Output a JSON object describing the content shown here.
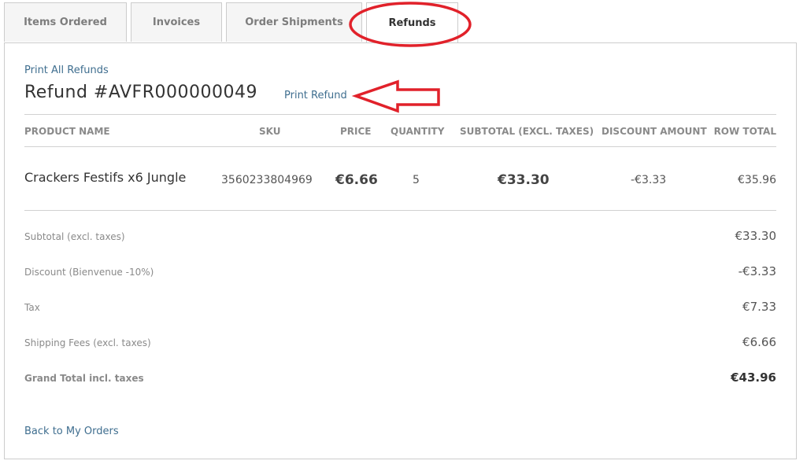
{
  "tabs": [
    {
      "label": "Items Ordered"
    },
    {
      "label": "Invoices"
    },
    {
      "label": "Order Shipments"
    },
    {
      "label": "Refunds"
    }
  ],
  "links": {
    "print_all": "Print All Refunds",
    "print_refund": "Print Refund",
    "back": "Back to My Orders"
  },
  "refund_title": "Refund #AVFR000000049",
  "table": {
    "headers": {
      "product": "PRODUCT NAME",
      "sku": "SKU",
      "price": "PRICE",
      "qty": "QUANTITY",
      "subtotal": "SUBTOTAL (EXCL. TAXES)",
      "discount": "DISCOUNT AMOUNT",
      "row_total": "ROW TOTAL"
    },
    "rows": [
      {
        "product": "Crackers Festifs x6 Jungle",
        "sku": "3560233804969",
        "price": "€6.66",
        "qty": "5",
        "subtotal": "€33.30",
        "discount": "-€3.33",
        "row_total": "€35.96"
      }
    ]
  },
  "totals": [
    {
      "label": "Subtotal (excl. taxes)",
      "value": "€33.30"
    },
    {
      "label": "Discount (Bienvenue -10%)",
      "value": "-€3.33"
    },
    {
      "label": "Tax",
      "value": "€7.33"
    },
    {
      "label": "Shipping Fees (excl. taxes)",
      "value": "€6.66"
    },
    {
      "label": "Grand Total incl. taxes",
      "value": "€43.96"
    }
  ],
  "colors": {
    "annotation_red": "#e1212a",
    "link_blue": "#3f6e8f"
  }
}
